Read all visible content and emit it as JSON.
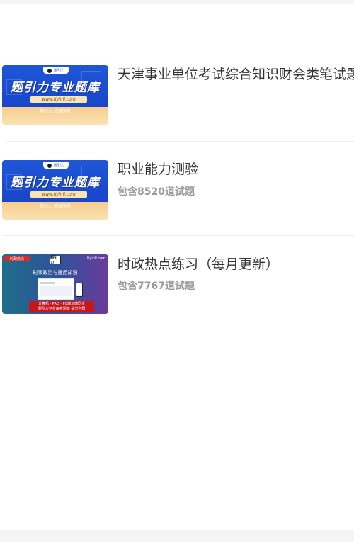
{
  "items": [
    {
      "title": "天津事业单位考试综合知识财会类笔试题",
      "meta": "",
      "thumb": {
        "headline": "题引力专业题库",
        "url": "www.tiylnii.com",
        "slogan": "题引力 成就所有",
        "logo_text": "题引力"
      }
    },
    {
      "title": "职业能力测验",
      "meta": "包含8520道试题",
      "thumb": {
        "headline": "题引力专业题库",
        "url": "www.tiylnii.com",
        "slogan": "题引力 成就所有",
        "logo_text": "题引力"
      }
    },
    {
      "title": "时政热点练习（每月更新）",
      "meta": "包含7767道试题",
      "thumb": {
        "tag": "时政热点",
        "logo": "题引力",
        "site": "tiyinli.com",
        "heading": "时事政治与适用知识",
        "box_line1": "计算机 · PAD · PC端三端同步",
        "box_line2": "题引力专业备考题库 提分利器"
      }
    }
  ],
  "colors": {
    "title": "#333333",
    "meta": "#9a9a9a",
    "divider": "#ececec",
    "banner_blue": "#1846c8"
  }
}
